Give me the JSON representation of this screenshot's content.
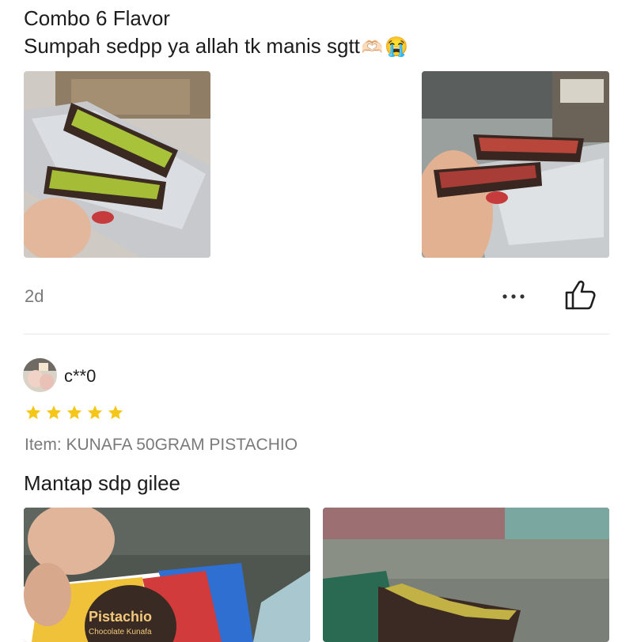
{
  "review1": {
    "line1": "Combo 6 Flavor",
    "line2": "Sumpah sedpp ya allah tk manis sgtt",
    "emoji1": "🫶🏻",
    "emoji2": "😭",
    "time": "2d",
    "more_icon": "more-dots-icon",
    "like_icon": "thumbs-up-icon"
  },
  "review2": {
    "username": "c**0",
    "rating": 5,
    "item_line": "Item: KUNAFA 50GRAM PISTACHIO",
    "body": "Mantap sdp gilee",
    "package_label": "Pistachio",
    "package_sub": "Chocolate Kunafa"
  },
  "colors": {
    "star": "#F5C518",
    "muted": "#7a7a7a",
    "divider": "#e8e8e8"
  }
}
